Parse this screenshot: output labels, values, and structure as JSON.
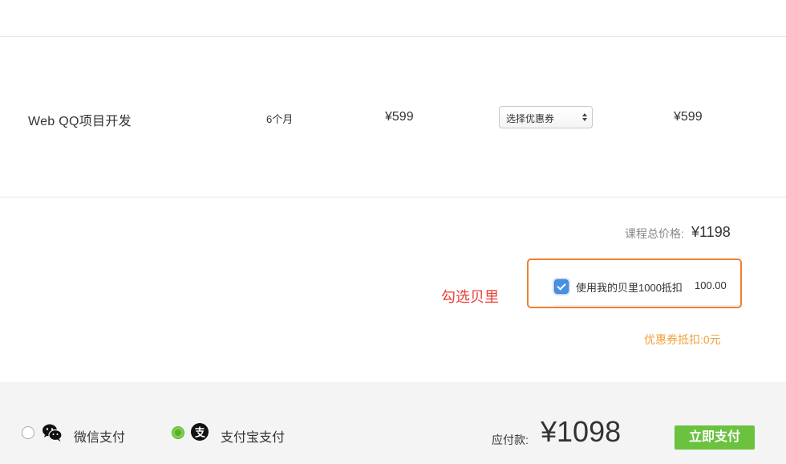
{
  "course": {
    "name": "Web QQ项目开发",
    "period": "6个月",
    "price": "¥599",
    "coupon_select": "选择优惠券",
    "subtotal": "¥599"
  },
  "summary": {
    "total_label": "课程总价格:",
    "total_value": "¥1198",
    "beili_label": "使用我的贝里1000抵扣",
    "beili_amount": "100.00",
    "beili_checked": true,
    "coupon_discount": "优惠券抵扣:0元"
  },
  "annotation": {
    "text": "勾选贝里",
    "color": "#e8403a",
    "box_color": "#ef7f35"
  },
  "payment": {
    "methods": [
      {
        "label": "微信支付",
        "icon": "wechat-icon",
        "selected": false
      },
      {
        "label": "支付宝支付",
        "icon": "alipay-icon",
        "selected": true
      }
    ],
    "payable_label": "应付款:",
    "payable_amount": "¥1098",
    "pay_button": "立即支付"
  },
  "colors": {
    "accent_green": "#6ac23f",
    "discount_orange": "#f0a23a",
    "checkbox_blue": "#4a90e2"
  }
}
